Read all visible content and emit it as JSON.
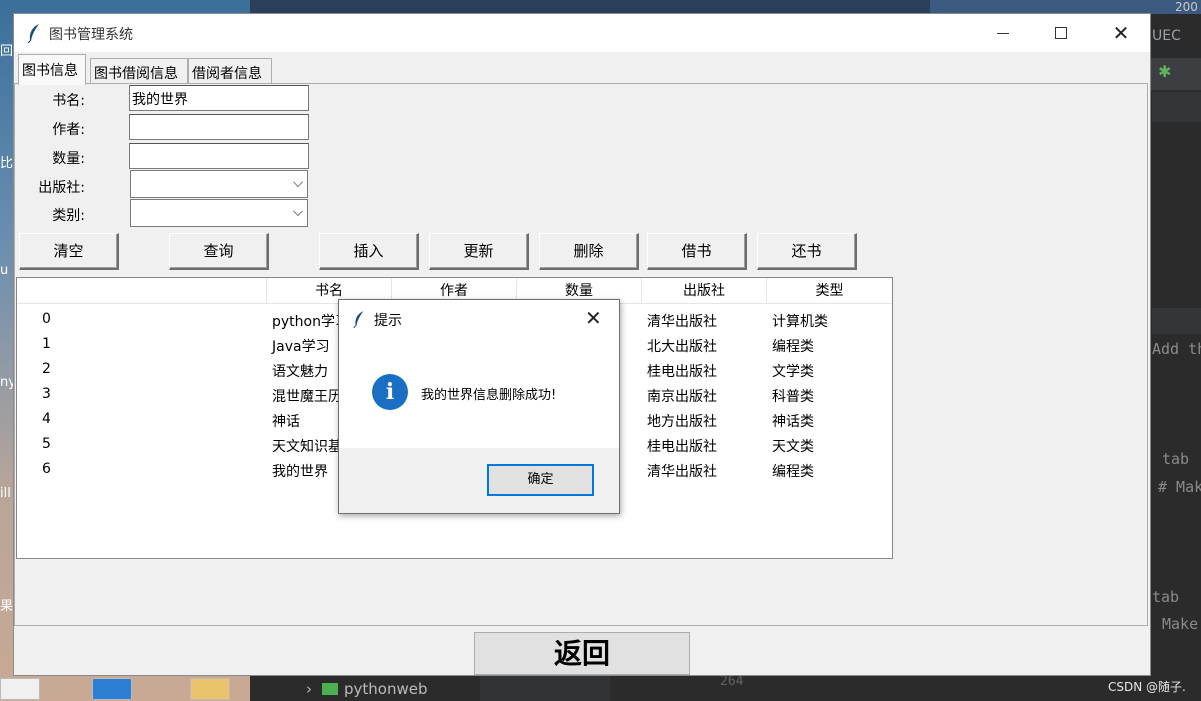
{
  "window": {
    "title": "图书管理系统",
    "tabs": [
      {
        "label": "图书信息",
        "active": true
      },
      {
        "label": "图书借阅信息",
        "active": false
      },
      {
        "label": "借阅者信息",
        "active": false
      }
    ]
  },
  "form": {
    "name_label": "书名:",
    "name_value": "我的世界",
    "author_label": "作者:",
    "author_value": "",
    "quantity_label": "数量:",
    "quantity_value": "",
    "publisher_label": "出版社:",
    "publisher_value": "",
    "category_label": "类别:",
    "category_value": ""
  },
  "buttons": {
    "clear": "清空",
    "query": "查询",
    "insert": "插入",
    "update": "更新",
    "delete": "删除",
    "borrow": "借书",
    "return": "还书"
  },
  "table": {
    "columns": [
      "书名",
      "作者",
      "数量",
      "出版社",
      "类型"
    ],
    "rows": [
      {
        "id": "0",
        "name": "python学习",
        "publisher": "清华出版社",
        "type": "计算机类"
      },
      {
        "id": "1",
        "name": "Java学习",
        "publisher": "北大出版社",
        "type": "编程类"
      },
      {
        "id": "2",
        "name": "语文魅力",
        "publisher": "桂电出版社",
        "type": "文学类"
      },
      {
        "id": "3",
        "name": "混世魔王历",
        "publisher": "南京出版社",
        "type": "科普类"
      },
      {
        "id": "4",
        "name": "神话",
        "publisher": "地方出版社",
        "type": "神话类"
      },
      {
        "id": "5",
        "name": "天文知识基",
        "publisher": "桂电出版社",
        "type": "天文类"
      },
      {
        "id": "6",
        "name": "我的世界",
        "publisher": "清华出版社",
        "type": "编程类"
      }
    ]
  },
  "back_button": "返回",
  "dialog": {
    "title": "提示",
    "message": "我的世界信息删除成功!",
    "ok": "确定",
    "icon": "info-icon",
    "icon_glyph": "i"
  },
  "background": {
    "project_folder": "pythonweb",
    "line_number": "264",
    "ide_snippets": [
      "UEC",
      "Add th",
      "tab",
      "# Mak",
      "tab",
      "Make"
    ],
    "top_right_text": "200",
    "watermark": "CSDN @随子."
  },
  "colors": {
    "accent": "#0078d7",
    "info_icon": "#1a6fc4",
    "window_bg": "#f0f0f0"
  }
}
